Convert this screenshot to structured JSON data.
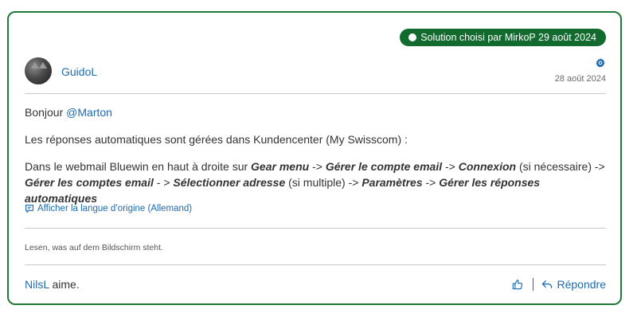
{
  "post": {
    "badge": "Solution choisi par MirkoP 29 août 2024",
    "author": "GuidoL",
    "date": "28 août 2024",
    "greeting": "Bonjour ",
    "mention": "@Marton",
    "line2": "Les réponses automatiques sont gérées dans Kundencenter (My Swisscom) :",
    "path": {
      "t1": "Dans le webmail Bluewin en haut à droite sur ",
      "b1": "Gear menu",
      "t2": " -> ",
      "b2": "Gérer le compte email",
      "t3": " -> ",
      "b3": "Connexion",
      "t4": " (si nécessaire) -> ",
      "b4": "Gérer les comptes email",
      "t5": " - > ",
      "b5": "Sélectionner adresse",
      "t6": " (si multiple) -> ",
      "b6": "Paramètres",
      "t7": " -> ",
      "b7": "Gérer les réponses automatiques"
    },
    "translate_link": "Afficher la langue d’origine (Allemand)",
    "signature": "Lesen, was auf dem Bildschirm steht.",
    "liker": "NilsL",
    "likes_suffix": " aime.",
    "reply_label": "Répondre"
  },
  "icons": {
    "gear": "gear-icon",
    "translate": "speech-bubble-icon",
    "like": "thumbs-up-icon",
    "reply": "reply-arrow-icon"
  },
  "colors": {
    "accent": "#1c6bb0",
    "solution": "#126a2f",
    "border": "#1f7a3a"
  }
}
